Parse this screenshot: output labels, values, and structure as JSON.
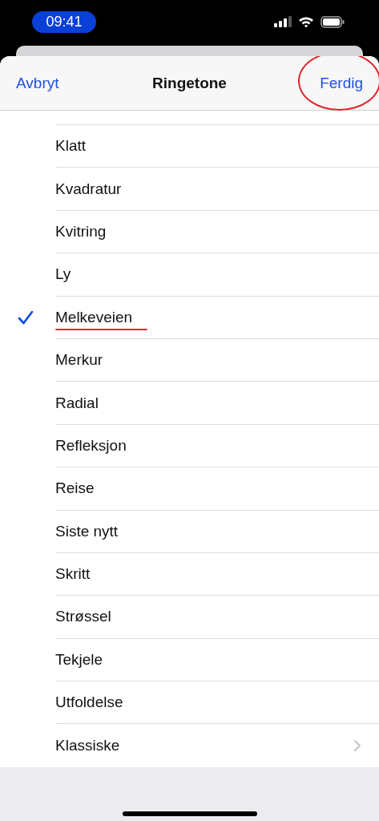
{
  "status_bar": {
    "time": "09:41"
  },
  "nav": {
    "cancel": "Avbryt",
    "title": "Ringetone",
    "done": "Ferdig",
    "done_circled": true
  },
  "rows": [
    {
      "kind": "tone",
      "label": "Klatt",
      "selected": false,
      "underlined": false
    },
    {
      "kind": "tone",
      "label": "Kvadratur",
      "selected": false,
      "underlined": false
    },
    {
      "kind": "tone",
      "label": "Kvitring",
      "selected": false,
      "underlined": false
    },
    {
      "kind": "tone",
      "label": "Ly",
      "selected": false,
      "underlined": false
    },
    {
      "kind": "tone",
      "label": "Melkeveien",
      "selected": true,
      "underlined": true
    },
    {
      "kind": "tone",
      "label": "Merkur",
      "selected": false,
      "underlined": false
    },
    {
      "kind": "tone",
      "label": "Radial",
      "selected": false,
      "underlined": false
    },
    {
      "kind": "tone",
      "label": "Refleksjon",
      "selected": false,
      "underlined": false
    },
    {
      "kind": "tone",
      "label": "Reise",
      "selected": false,
      "underlined": false
    },
    {
      "kind": "tone",
      "label": "Siste nytt",
      "selected": false,
      "underlined": false
    },
    {
      "kind": "tone",
      "label": "Skritt",
      "selected": false,
      "underlined": false
    },
    {
      "kind": "tone",
      "label": "Strøssel",
      "selected": false,
      "underlined": false
    },
    {
      "kind": "tone",
      "label": "Tekjele",
      "selected": false,
      "underlined": false
    },
    {
      "kind": "tone",
      "label": "Utfoldelse",
      "selected": false,
      "underlined": false
    },
    {
      "kind": "link",
      "label": "Klassiske"
    }
  ]
}
